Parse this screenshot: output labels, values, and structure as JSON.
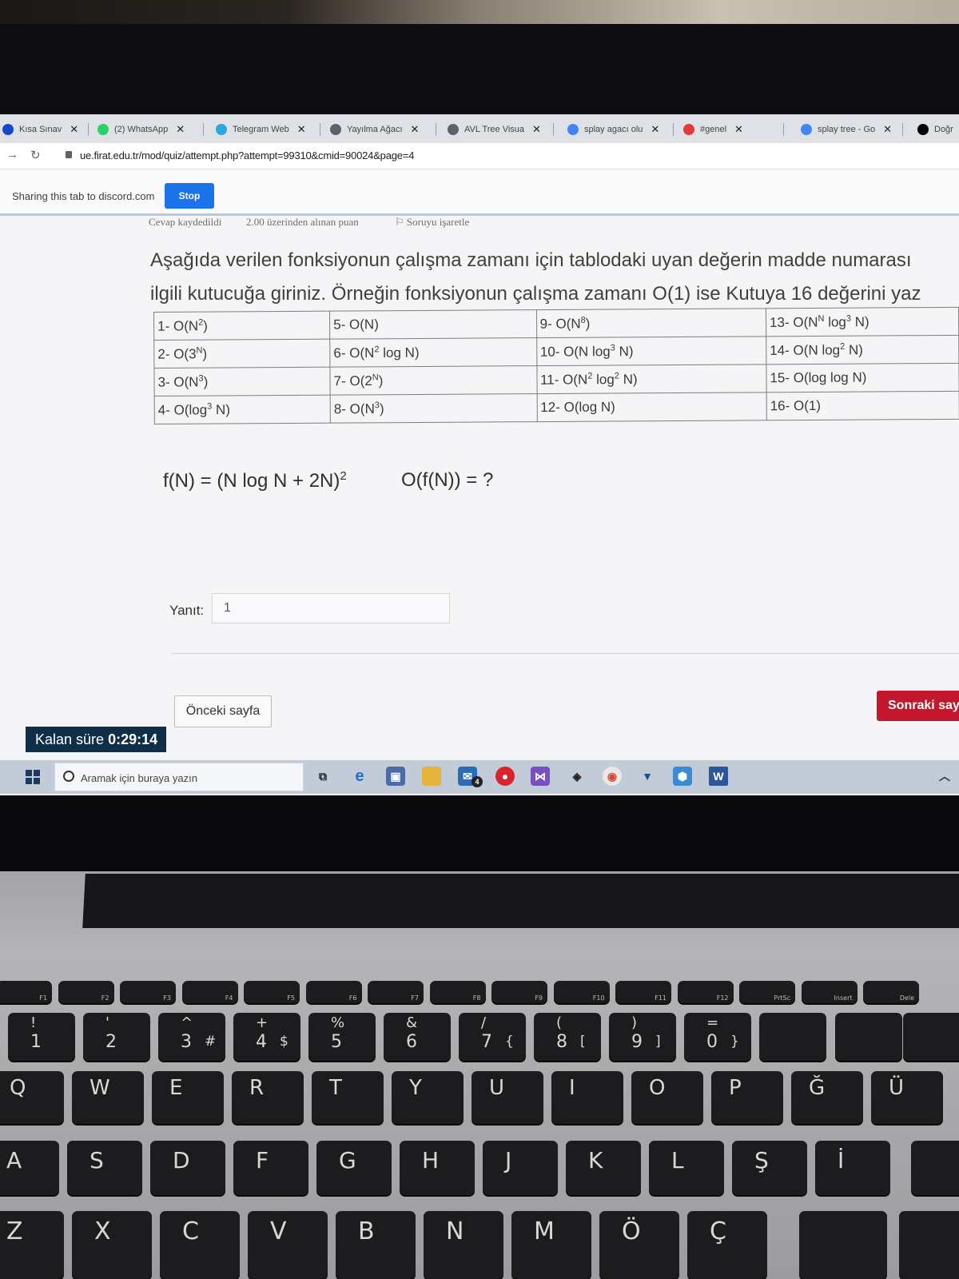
{
  "browser": {
    "tabs": [
      {
        "label": "Kısa Sınav",
        "icon": "moodle-icon",
        "icon_color": "#1a47c9"
      },
      {
        "label": "(2) WhatsApp",
        "icon": "whatsapp-icon",
        "icon_color": "#25d366"
      },
      {
        "label": "Telegram Web",
        "icon": "telegram-icon",
        "icon_color": "#2ca5e0"
      },
      {
        "label": "Yayılma Ağacı",
        "icon": "globe-icon",
        "icon_color": "#5f6368"
      },
      {
        "label": "AVL Tree Visua",
        "icon": "globe-icon",
        "icon_color": "#5f6368"
      },
      {
        "label": "splay agacı olu",
        "icon": "google-icon",
        "icon_color": "#4285f4"
      },
      {
        "label": "#genel",
        "icon": "discord-icon",
        "icon_color": "#e53935"
      },
      {
        "label": "splay tree - Go",
        "icon": "google-icon",
        "icon_color": "#4285f4"
      },
      {
        "label": "Doğr",
        "icon": "medium-icon",
        "icon_color": "#000000"
      }
    ],
    "url": "ue.firat.edu.tr/mod/quiz/attempt.php?attempt=99310&cmid=90024&page=4",
    "share_notice": "Sharing this tab to discord.com",
    "stop_label": "Stop"
  },
  "quiz": {
    "info": {
      "status": "Cevap kaydedildi",
      "grade": "2.00 üzerinden alınan puan",
      "flag": "Soruyu işaretle"
    },
    "question_line1": "Aşağıda verilen fonksiyonun çalışma zamanı için tablodaki uyan değerin madde numarası",
    "question_line2": "ilgili kutucuğa giriniz. Örneğin fonksiyonun çalışma zamanı O(1) ise Kutuya 16 değerini yaz",
    "table": [
      [
        {
          "pre": "1- O(N",
          "sup": "2",
          "post": ")"
        },
        {
          "pre": "5- O(N)",
          "sup": "",
          "post": ""
        },
        {
          "pre": "9- O(N",
          "sup": "8",
          "post": ")"
        },
        {
          "pre": "13- O(N",
          "sup": "N",
          "mid": " log",
          "sup2": "3",
          "post": " N)"
        }
      ],
      [
        {
          "pre": "2- O(3",
          "sup": "N",
          "post": ")"
        },
        {
          "pre": "6- O(N",
          "sup": "2",
          "post": " log N)"
        },
        {
          "pre": "10- O(N log",
          "sup": "3",
          "post": " N)"
        },
        {
          "pre": "14- O(N log",
          "sup": "2",
          "post": " N)"
        }
      ],
      [
        {
          "pre": "3- O(N",
          "sup": "3",
          "post": ")"
        },
        {
          "pre": "7- O(2",
          "sup": "N",
          "post": ")"
        },
        {
          "pre": "11- O(N",
          "sup": "2",
          "mid": " log",
          "sup2": "2",
          "post": " N)"
        },
        {
          "pre": "15- O(log log N)",
          "sup": "",
          "post": ""
        }
      ],
      [
        {
          "pre": "4- O(log",
          "sup": "3",
          "post": " N)"
        },
        {
          "pre": "8- O(N",
          "sup": "3",
          "post": ")"
        },
        {
          "pre": "12- O(log N)",
          "sup": "",
          "post": ""
        },
        {
          "pre": "16- O(1)",
          "sup": "",
          "post": ""
        }
      ]
    ],
    "formula_pre": "f(N) = (N log N + 2N)",
    "formula_sup": "2",
    "formula_question": "O(f(N)) = ?",
    "answer_label": "Yanıt:",
    "answer_value": "1",
    "prev_label": "Önceki sayfa",
    "next_label": "Sonraki sayf",
    "timer_label": "Kalan süre",
    "timer_value": "0:29:14"
  },
  "taskbar": {
    "search_placeholder": "Aramak için buraya yazın",
    "mail_badge": "4"
  },
  "keyboard": {
    "fn_row": [
      "F1",
      "F2",
      "F3",
      "F4",
      "F5",
      "F6",
      "F7",
      "F8",
      "F9",
      "F10",
      "F11",
      "F12",
      "PrtSc",
      "Insert",
      "Dele"
    ],
    "number_row": [
      "1",
      "2",
      "3",
      "4",
      "5",
      "6",
      "7",
      "8",
      "9",
      "0"
    ],
    "number_row_symbols": [
      "!",
      "'",
      "^",
      "+",
      "%",
      "&",
      "/",
      "(",
      ")",
      "="
    ],
    "number_row_alt": [
      "",
      "",
      "#",
      "$",
      "",
      "",
      "{",
      "[",
      "]",
      "}"
    ],
    "row_q": [
      "Q",
      "W",
      "E",
      "R",
      "T",
      "Y",
      "U",
      "I",
      "O",
      "P",
      "Ğ",
      "Ü"
    ],
    "row_a": [
      "A",
      "S",
      "D",
      "F",
      "G",
      "H",
      "J",
      "K",
      "L",
      "Ş",
      "İ"
    ],
    "row_z": [
      "Z",
      "X",
      "C",
      "V",
      "B",
      "N",
      "M",
      "Ö",
      "Ç"
    ],
    "alt_glyphs": {
      "q_alt": "@",
      "e_alt": "€",
      "u_alt": "¨",
      "tilde": "~",
      "question": "?",
      "star": "*"
    }
  }
}
